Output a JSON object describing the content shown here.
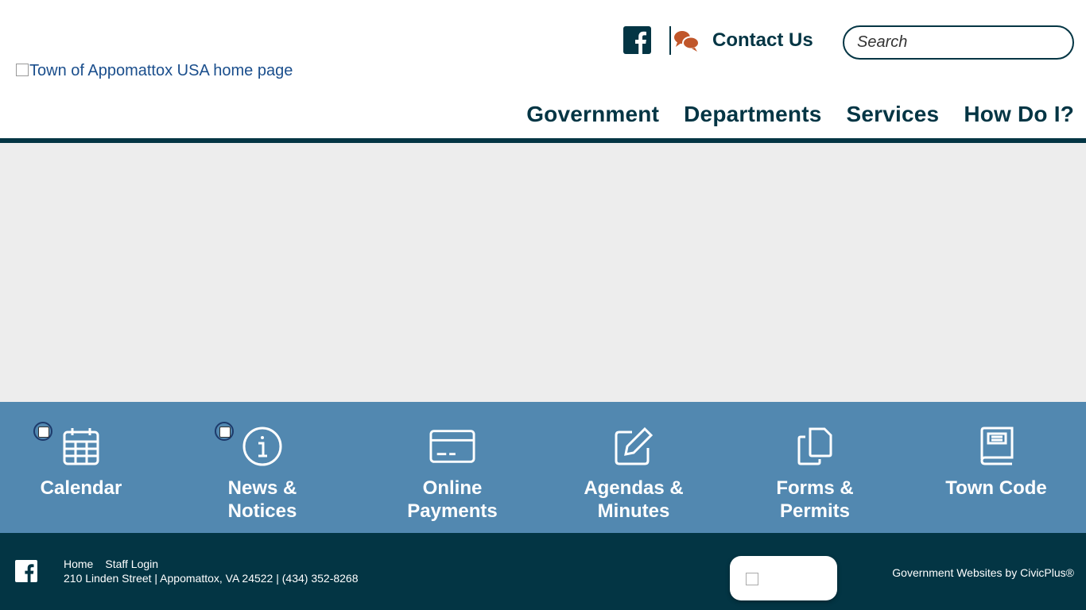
{
  "header": {
    "logo_alt": "Town of Appomattox USA home page",
    "contact_label": "Contact Us",
    "search_placeholder": "Search",
    "nav": [
      "Government",
      "Departments",
      "Services",
      "How Do I?"
    ]
  },
  "quick_links": [
    {
      "label_line1": "Calendar",
      "label_line2": "",
      "icon": "calendar-icon"
    },
    {
      "label_line1": "News &",
      "label_line2": "Notices",
      "icon": "info-icon"
    },
    {
      "label_line1": "Online",
      "label_line2": "Payments",
      "icon": "credit-card-icon"
    },
    {
      "label_line1": "Agendas &",
      "label_line2": "Minutes",
      "icon": "edit-icon"
    },
    {
      "label_line1": "Forms &",
      "label_line2": "Permits",
      "icon": "copy-icon"
    },
    {
      "label_line1": "Town Code",
      "label_line2": "",
      "icon": "book-icon"
    }
  ],
  "footer": {
    "links": [
      "Home",
      "Staff Login"
    ],
    "address": "210 Linden Street | Appomattox, VA 24522 | (434) 352-8268",
    "credit": "Government Websites by CivicPlus®"
  },
  "colors": {
    "primary": "#033544",
    "quick_bar": "#5288b0",
    "banner": "#ededed",
    "accent_orange": "#c0562a"
  }
}
